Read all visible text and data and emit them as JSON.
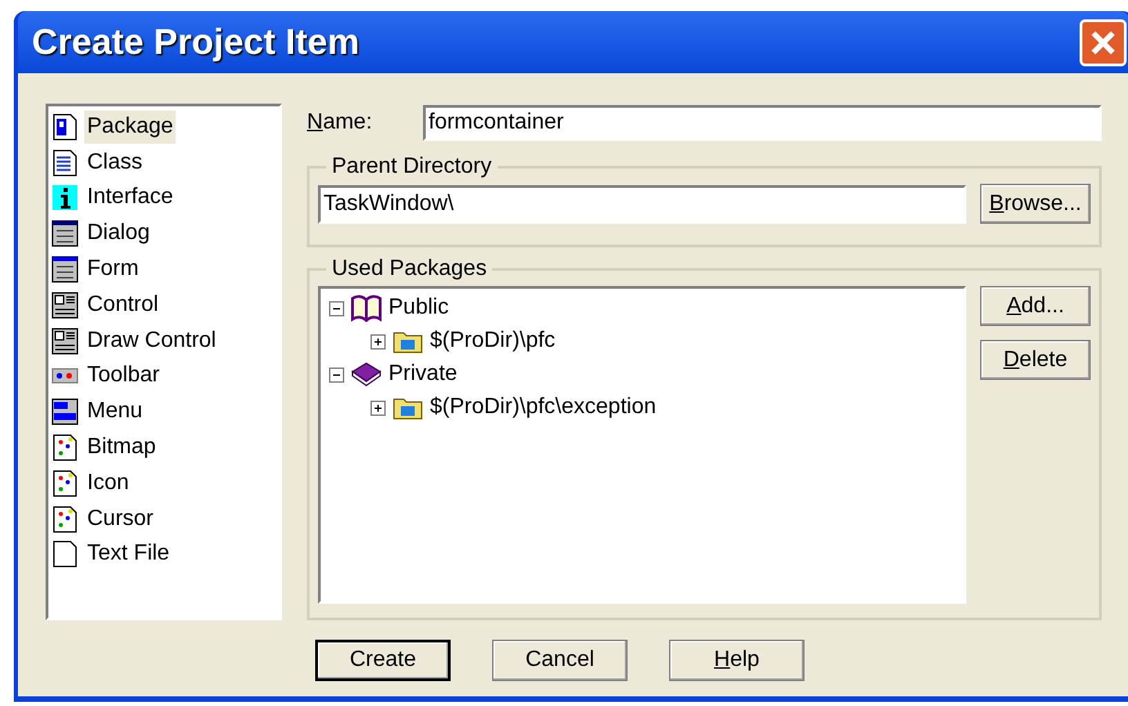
{
  "window": {
    "title": "Create Project Item"
  },
  "item_types": [
    {
      "label": "Package",
      "kind": "package",
      "selected": true
    },
    {
      "label": "Class",
      "kind": "class",
      "selected": false
    },
    {
      "label": "Interface",
      "kind": "interface",
      "selected": false
    },
    {
      "label": "Dialog",
      "kind": "dialog",
      "selected": false
    },
    {
      "label": "Form",
      "kind": "form",
      "selected": false
    },
    {
      "label": "Control",
      "kind": "control",
      "selected": false
    },
    {
      "label": "Draw Control",
      "kind": "control",
      "selected": false
    },
    {
      "label": "Toolbar",
      "kind": "toolbar",
      "selected": false
    },
    {
      "label": "Menu",
      "kind": "menu",
      "selected": false
    },
    {
      "label": "Bitmap",
      "kind": "image",
      "selected": false
    },
    {
      "label": "Icon",
      "kind": "image",
      "selected": false
    },
    {
      "label": "Cursor",
      "kind": "image",
      "selected": false
    },
    {
      "label": "Text File",
      "kind": "text",
      "selected": false
    }
  ],
  "name_field": {
    "label": "Name:",
    "value": "formcontainer"
  },
  "parent_directory": {
    "title": "Parent Directory",
    "value": "TaskWindow\\",
    "button": "Browse..."
  },
  "used_packages": {
    "title": "Used Packages",
    "tree": [
      {
        "label": "Public",
        "kind": "public",
        "expanded": true,
        "children": [
          {
            "label": "$(ProDir)\\pfc",
            "kind": "package",
            "expanded": false
          }
        ]
      },
      {
        "label": "Private",
        "kind": "private",
        "expanded": true,
        "children": [
          {
            "label": "$(ProDir)\\pfc\\exception",
            "kind": "package",
            "expanded": false
          }
        ]
      }
    ],
    "buttons": [
      "Add...",
      "Delete"
    ]
  },
  "buttons": [
    {
      "label": "Create",
      "default": true,
      "mnemonic": false
    },
    {
      "label": "Cancel",
      "default": false,
      "mnemonic": false
    },
    {
      "label": "Help",
      "default": false,
      "mnemonic": true
    }
  ]
}
